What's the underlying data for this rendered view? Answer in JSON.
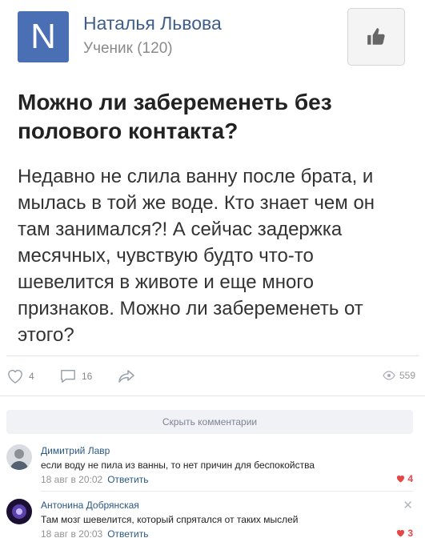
{
  "post": {
    "avatar_letter": "N",
    "author": "Наталья Львова",
    "author_sub": "Ученик (120)",
    "title": "Можно ли забеременеть без полового контакта?",
    "body": "Недавно не слила ванну после брата, и мылась в той же воде. Кто знает чем он там занимался?! А сейчас задержка месячных, чувствую будто что-то шевелится в животе и еще много признаков. Можно ли забеременеть от этого?"
  },
  "actions": {
    "likes": "4",
    "comments": "16",
    "views": "559"
  },
  "hide_comments_label": "Скрыть комментарии",
  "comments": [
    {
      "name": "Димитрий Лавр",
      "text": "если воду не пила из ванны, то нет причин для беспокойства",
      "date": "18 авг в 20:02",
      "reply": "Ответить",
      "likes": "4"
    },
    {
      "name": "Антонина Добрянская",
      "text": "Там мозг шевелится, который спрятался от таких мыслей",
      "date": "18 авг в 20:03",
      "reply": "Ответить",
      "likes": "3"
    }
  ],
  "colors": {
    "link": "#2a5885",
    "like_red": "#e64646",
    "avatar_bg": "#4a6fb5"
  }
}
